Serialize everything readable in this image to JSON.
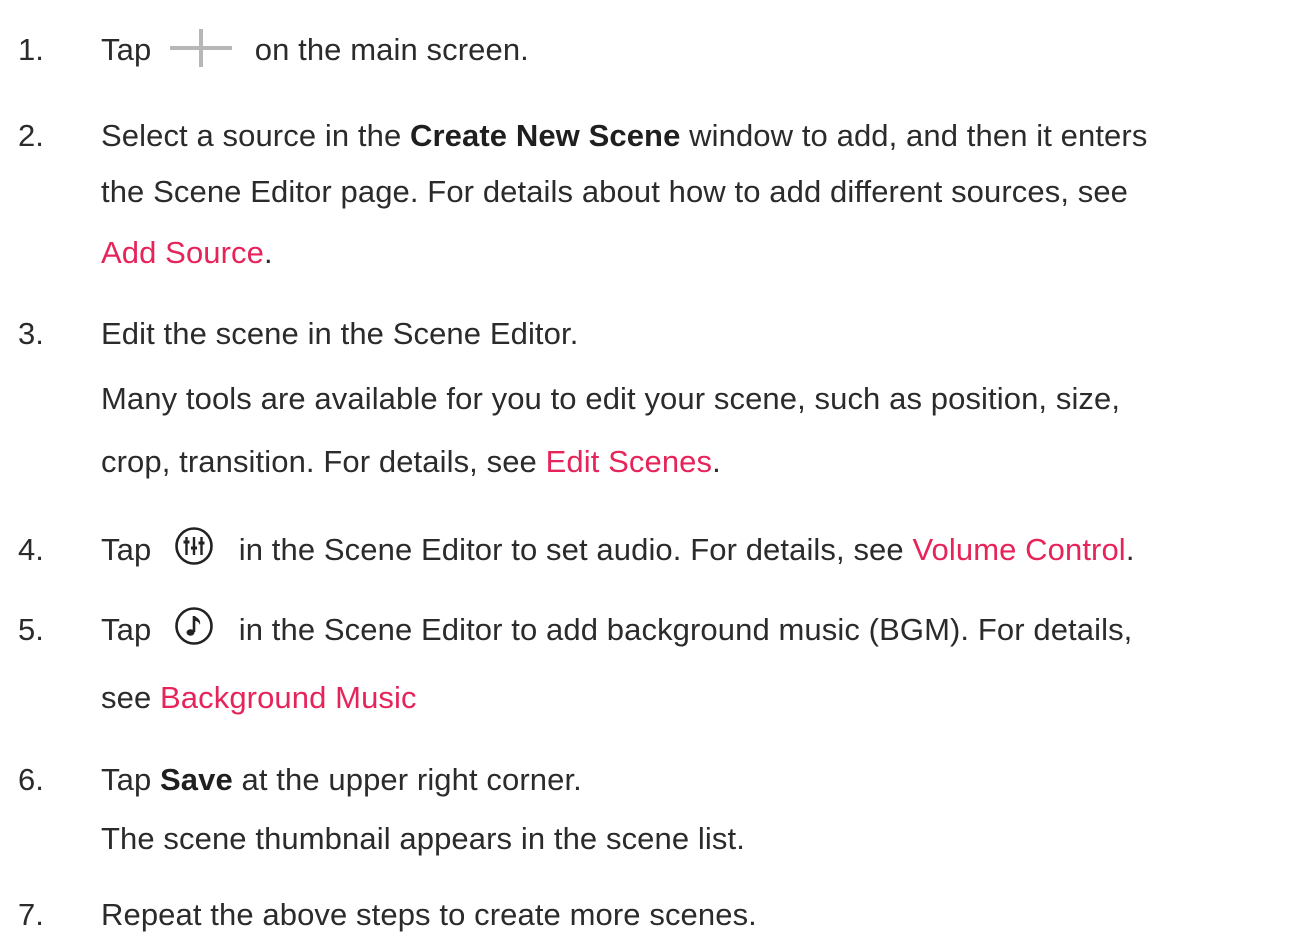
{
  "steps": [
    {
      "number": "1.",
      "parts": [
        "Tap",
        "on the main screen."
      ]
    },
    {
      "number": "2.",
      "line1_pre": "Select a source in the ",
      "line1_bold": "Create New Scene",
      "line1_post": " window to add, and then it enters",
      "line2": "the Scene Editor page. For details about how to add different sources, see",
      "link": "Add Source",
      "after_link": "."
    },
    {
      "number": "3.",
      "line1": "Edit the scene in the Scene Editor.",
      "line2": "Many tools are available for you to edit your scene, such as position, size,",
      "line3_pre": "crop, transition. For details, see ",
      "link": "Edit Scenes",
      "after_link": "."
    },
    {
      "number": "4.",
      "pre": "Tap",
      "post": "in the Scene Editor to set audio. For details, see ",
      "link": "Volume Control",
      "after_link": "."
    },
    {
      "number": "5.",
      "pre": "Tap",
      "post": "in the Scene Editor to add background music (BGM). For details,",
      "line2_pre": "see ",
      "link": "Background Music"
    },
    {
      "number": "6.",
      "pre": "Tap ",
      "bold": "Save",
      "post": " at the upper right corner.",
      "line2": "The scene thumbnail appears in the scene list."
    },
    {
      "number": "7.",
      "line1": "Repeat the above steps to create more scenes."
    }
  ],
  "icons": {
    "step1": "plus-icon",
    "step4": "audio-mixer-icon",
    "step5": "music-note-icon"
  },
  "colors": {
    "link": "#e6245a",
    "text": "#2b2b2b",
    "icon_gray": "#b7b7b7"
  }
}
